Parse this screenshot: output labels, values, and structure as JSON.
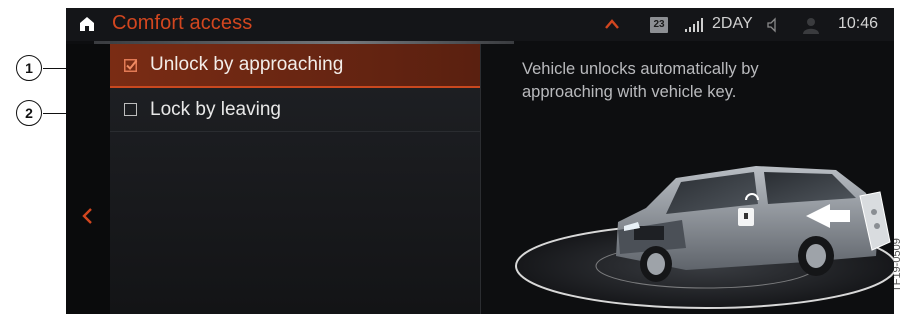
{
  "header": {
    "title": "Comfort access"
  },
  "status_bar": {
    "calendar_day": "23",
    "network": "2DAY",
    "time": "10:46"
  },
  "menu": {
    "items": [
      {
        "label": "Unlock by approaching",
        "checked": true
      },
      {
        "label": "Lock by leaving",
        "checked": false
      }
    ]
  },
  "info": {
    "description": "Vehicle unlocks automatically by approaching with vehicle key."
  },
  "callouts": [
    {
      "number": "1"
    },
    {
      "number": "2"
    }
  ],
  "figure_code": "TF19-0509",
  "colors": {
    "accent": "#d2461f",
    "selected_row": "#6a2612",
    "background": "#0d0e10"
  },
  "icons": [
    "home-icon",
    "chevron-up-icon",
    "calendar-icon",
    "signal-icon",
    "speaker-icon",
    "profile-icon",
    "back-chevron-icon",
    "checkbox-checked-icon",
    "checkbox-icon",
    "car-illustration"
  ]
}
